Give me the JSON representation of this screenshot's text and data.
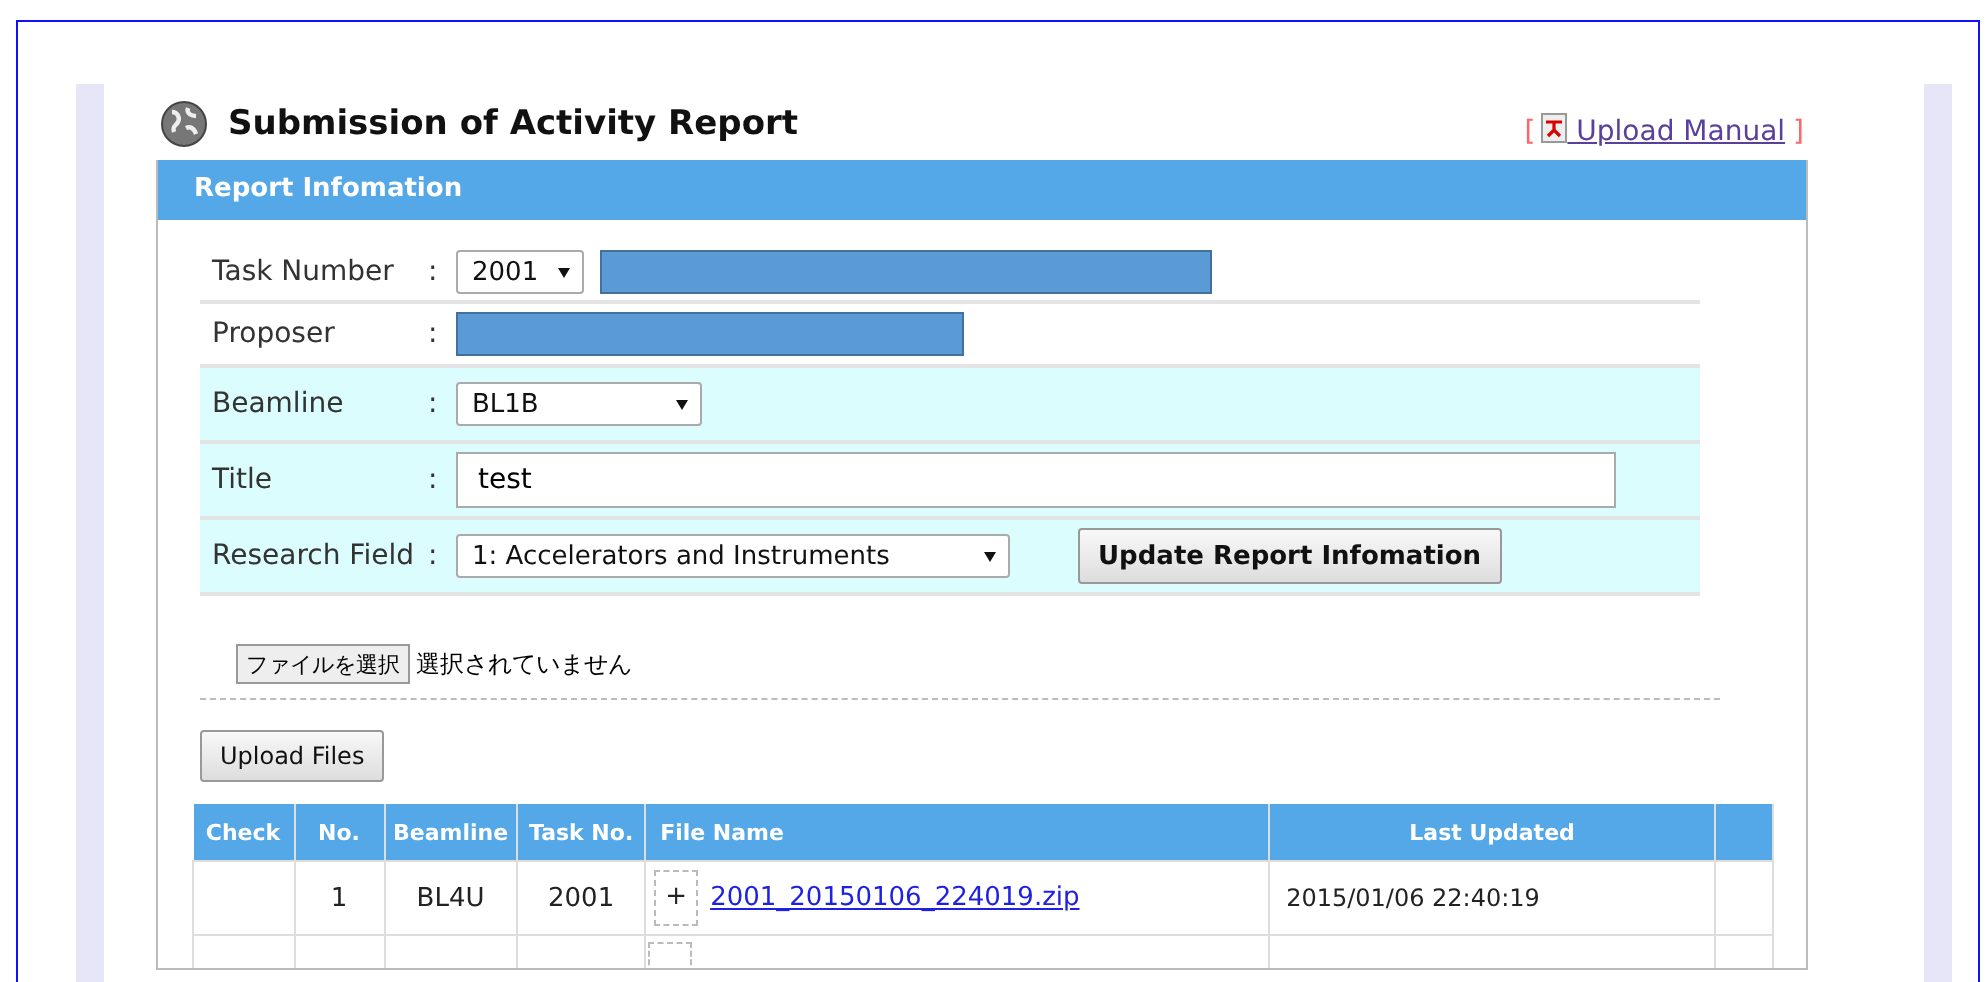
{
  "page": {
    "title": "Submission of Activity Report",
    "manual_link": {
      "bracket_open": "[",
      "label": "Upload Manual",
      "bracket_close": "]"
    }
  },
  "report_info": {
    "header": "Report Infomation",
    "rows": [
      {
        "kind": "select-redacted",
        "label": "Task Number",
        "colon": ":",
        "value": "2001",
        "shaded": false
      },
      {
        "kind": "redacted",
        "label": "Proposer",
        "colon": ":",
        "shaded": false
      },
      {
        "kind": "select",
        "label": "Beamline",
        "colon": ":",
        "value": "BL1B",
        "shaded": true
      },
      {
        "kind": "text",
        "label": "Title",
        "colon": ":",
        "value": "test",
        "shaded": true
      },
      {
        "kind": "select-button",
        "label": "Research Field",
        "colon": ":",
        "value": "1: Accelerators and Instruments",
        "button": "Update Report Infomation",
        "shaded": true
      }
    ]
  },
  "file_picker": {
    "button": "ファイルを選択",
    "status": "選択されていません"
  },
  "upload_button": "Upload Files",
  "table": {
    "columns": [
      "Check",
      "No.",
      "Beamline",
      "Task No.",
      "File Name",
      "Last Updated"
    ],
    "rows": [
      {
        "no": "1",
        "beamline": "BL4U",
        "task_no": "2001",
        "expand": "+",
        "file_name": "2001_20150106_224019.zip",
        "last_updated": "2015/01/06 22:40:19"
      }
    ]
  }
}
